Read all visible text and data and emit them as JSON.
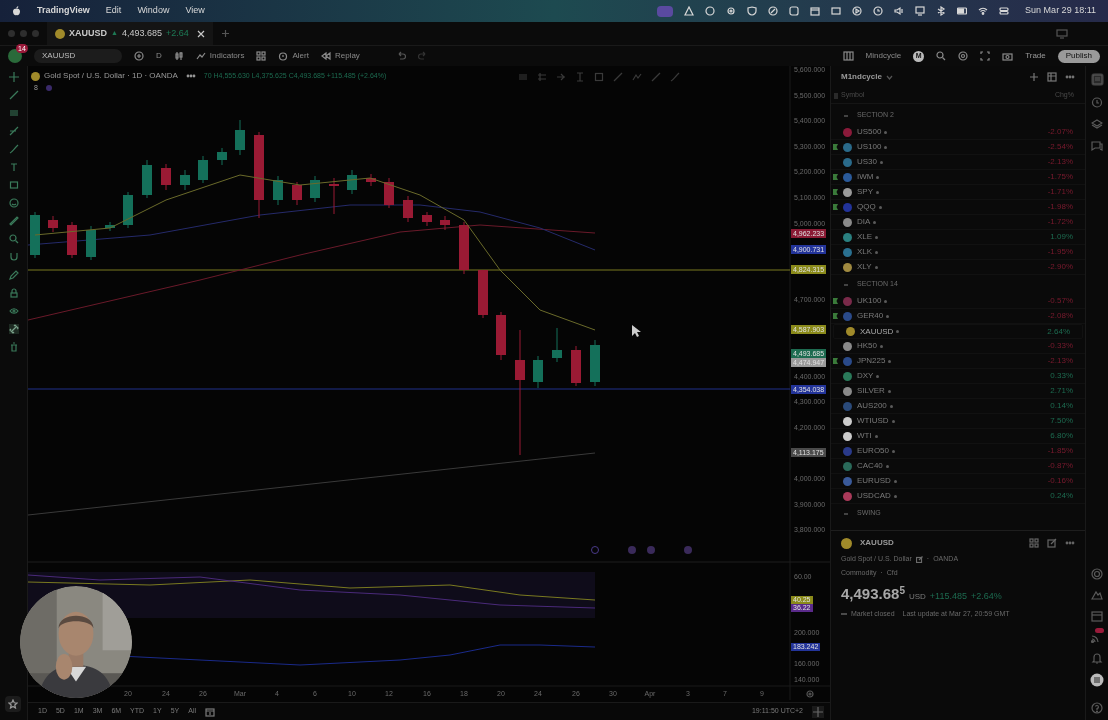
{
  "menubar": {
    "app": "TradingView",
    "menus": [
      "Edit",
      "Window",
      "View"
    ],
    "clock": "Sun Mar 29  18:11"
  },
  "tab": {
    "symbol": "XAUUSD",
    "arrow": "▲",
    "price": "4,493.685",
    "change": "+2.64"
  },
  "toolbar": {
    "avatar_badge": "14",
    "symbol": "XAUUSD",
    "interval": "D",
    "indicators": "Indicators",
    "alert": "Alert",
    "replay": "Replay",
    "layout": "Mindcycle",
    "user_initial": "M",
    "trade": "Trade",
    "publish": "Publish"
  },
  "chart": {
    "title": "Gold Spot / U.S. Dollar · 1D · OANDA",
    "ohlc": "70 H4,555.630 L4,375.625 C4,493.685 +115.485 (+2.64%)",
    "indicator_count": "8",
    "price_ticks": [
      "5,600.000",
      "5,500.000",
      "5,400.000",
      "5,300.000",
      "5,200.000",
      "5,100.000",
      "5,000.000",
      "4,700.000",
      "4,400.000",
      "4,300.000",
      "4,200.000",
      "4,000.000",
      "3,900.000",
      "3,800.000"
    ],
    "price_markers": [
      {
        "label": "4,962.233",
        "color": "#8a1a34"
      },
      {
        "label": "4,900.731",
        "color": "#23349a"
      },
      {
        "label": "4,824.315",
        "color": "#8a8a1a"
      },
      {
        "label": "4,587.903",
        "color": "#8a8a1a"
      },
      {
        "label": "4,493.685",
        "color": "#1d6b50"
      },
      {
        "label": "4,474.947",
        "color": "#9a9a9a"
      },
      {
        "label": "4,354.038",
        "color": "#23349a"
      },
      {
        "label": "4,113.175",
        "color": "#4a4a4a"
      }
    ],
    "osc_ticks": [
      "60.00",
      "200.000",
      "160.000",
      "140.000"
    ],
    "osc_markers": [
      {
        "label": "40.25",
        "color": "#8a8a1a"
      },
      {
        "label": "36.22",
        "color": "#5a2a8a"
      },
      {
        "label": "183.242",
        "color": "#23349a"
      }
    ],
    "time_ticks": [
      "20",
      "24",
      "26",
      "Mar",
      "4",
      "6",
      "10",
      "12",
      "16",
      "18",
      "20",
      "24",
      "26",
      "30",
      "Apr",
      "3",
      "7",
      "9"
    ]
  },
  "bottom_bar": {
    "ranges": [
      "1D",
      "5D",
      "1M",
      "3M",
      "6M",
      "YTD",
      "1Y",
      "5Y",
      "All"
    ],
    "clock": "19:11:50 UTC+2"
  },
  "watchlist": {
    "name": "M1ndcycle",
    "columns": [
      "Symbol",
      "Chg%"
    ],
    "sections": [
      {
        "title": "SECTION 2",
        "items": [
          {
            "symbol": "US500",
            "change": "-2.07%",
            "positive": false,
            "flagged": false,
            "selected": false,
            "color": "#8a1a3a"
          },
          {
            "symbol": "US100",
            "change": "-2.54%",
            "positive": false,
            "flagged": true,
            "selected": false,
            "color": "#2a6a8a"
          },
          {
            "symbol": "US30",
            "change": "-2.13%",
            "positive": false,
            "flagged": false,
            "selected": false,
            "color": "#2a6a8a"
          },
          {
            "symbol": "IWM",
            "change": "-1.75%",
            "positive": false,
            "flagged": true,
            "selected": false,
            "color": "#2a5a9a"
          },
          {
            "symbol": "SPY",
            "change": "-1.71%",
            "positive": false,
            "flagged": true,
            "selected": false,
            "color": "#9a9a9a"
          },
          {
            "symbol": "QQQ",
            "change": "-1.98%",
            "positive": false,
            "flagged": true,
            "selected": false,
            "color": "#22339a"
          },
          {
            "symbol": "DIA",
            "change": "-1.72%",
            "positive": false,
            "flagged": false,
            "selected": false,
            "color": "#8a8a8a"
          },
          {
            "symbol": "XLE",
            "change": "1.09%",
            "positive": true,
            "flagged": false,
            "selected": false,
            "color": "#2a8080"
          },
          {
            "symbol": "XLK",
            "change": "-1.95%",
            "positive": false,
            "flagged": false,
            "selected": false,
            "color": "#2a7090"
          },
          {
            "symbol": "XLY",
            "change": "-2.90%",
            "positive": false,
            "flagged": false,
            "selected": false,
            "color": "#a08a40"
          }
        ]
      },
      {
        "title": "SECTION 14",
        "items": [
          {
            "symbol": "UK100",
            "change": "-0.57%",
            "positive": false,
            "flagged": true,
            "selected": false,
            "color": "#7a2a4a"
          },
          {
            "symbol": "GER40",
            "change": "-2.08%",
            "positive": false,
            "flagged": true,
            "selected": false,
            "color": "#2a4a8a"
          },
          {
            "symbol": "XAUUSD",
            "change": "2.64%",
            "positive": true,
            "flagged": false,
            "selected": true,
            "color": "#a08a2a"
          },
          {
            "symbol": "HK50",
            "change": "-0.33%",
            "positive": false,
            "flagged": false,
            "selected": false,
            "color": "#8a8a8a"
          },
          {
            "symbol": "JPN225",
            "change": "-2.13%",
            "positive": false,
            "flagged": true,
            "selected": false,
            "color": "#2a4a8a"
          },
          {
            "symbol": "DXY",
            "change": "0.33%",
            "positive": true,
            "flagged": false,
            "selected": false,
            "color": "#2a7a5a"
          },
          {
            "symbol": "SILVER",
            "change": "2.71%",
            "positive": true,
            "flagged": false,
            "selected": false,
            "color": "#8a8a8a"
          },
          {
            "symbol": "AUS200",
            "change": "0.14%",
            "positive": true,
            "flagged": false,
            "selected": false,
            "color": "#2a4a7a"
          },
          {
            "symbol": "WTIUSD",
            "change": "7.50%",
            "positive": true,
            "flagged": false,
            "selected": false,
            "color": "#cccccc"
          },
          {
            "symbol": "WTI",
            "change": "6.80%",
            "positive": true,
            "flagged": false,
            "selected": false,
            "color": "#cccccc"
          },
          {
            "symbol": "EURO50",
            "change": "-1.85%",
            "positive": false,
            "flagged": false,
            "selected": false,
            "color": "#2a3a8a"
          },
          {
            "symbol": "CAC40",
            "change": "-0.87%",
            "positive": false,
            "flagged": false,
            "selected": false,
            "color": "#2a6a5a"
          },
          {
            "symbol": "EURUSD",
            "change": "-0.16%",
            "positive": false,
            "flagged": false,
            "selected": false,
            "color": "#3a5a9a"
          },
          {
            "symbol": "USDCAD",
            "change": "0.24%",
            "positive": true,
            "flagged": false,
            "selected": false,
            "color": "#aa3a5a"
          }
        ]
      },
      {
        "title": "SWING"
      }
    ]
  },
  "details": {
    "symbol": "XAUUSD",
    "description": "Gold Spot / U.S. Dollar",
    "exchange_separator": "·",
    "exchange": "OANDA",
    "category": "Commodity",
    "type_separator": "·",
    "subtype": "Cfd",
    "price": "4,493.68",
    "price_last_digit": "5",
    "currency": "USD",
    "change": "+115.485",
    "change_pct": "+2.64%",
    "status": "Market closed",
    "updated": "Last update at Mar 27, 20:59 GMT"
  }
}
